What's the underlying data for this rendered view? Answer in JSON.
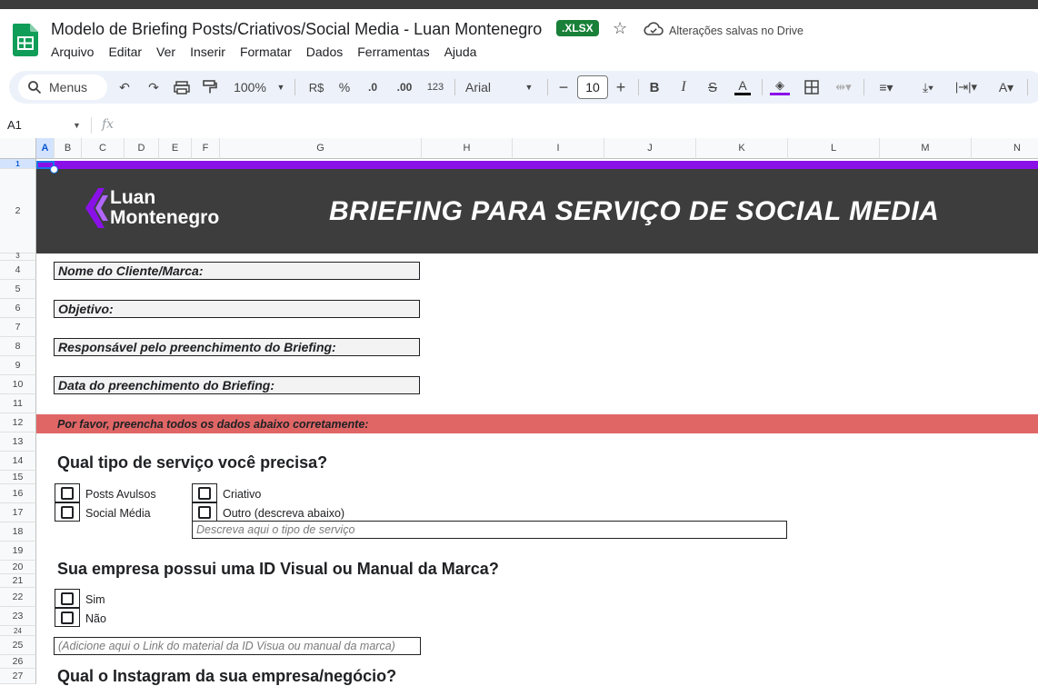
{
  "window": {
    "doc_title": "Modelo de Briefing Posts/Criativos/Social Media - Luan Montenegro",
    "badge": ".XLSX",
    "save_status": "Alterações salvas no Drive"
  },
  "menu": [
    "Arquivo",
    "Editar",
    "Ver",
    "Inserir",
    "Formatar",
    "Dados",
    "Ferramentas",
    "Ajuda"
  ],
  "toolbar": {
    "search_label": "Menus",
    "zoom": "100%",
    "currency": "R$",
    "percent": "%",
    "dec_decrease": ".0",
    "dec_increase": ".00",
    "number_format": "123",
    "font": "Arial",
    "font_size": "10"
  },
  "formula_bar": {
    "cell_ref": "A1",
    "fx": "fx"
  },
  "columns": [
    "A",
    "B",
    "C",
    "D",
    "E",
    "F",
    "G",
    "H",
    "I",
    "J",
    "K",
    "L",
    "M",
    "N"
  ],
  "rows": [
    "1",
    "2",
    "3",
    "4",
    "5",
    "6",
    "7",
    "8",
    "9",
    "10",
    "11",
    "12",
    "13",
    "14",
    "15",
    "16",
    "17",
    "18",
    "19",
    "20",
    "21",
    "22",
    "23",
    "24",
    "25",
    "26",
    "27"
  ],
  "sheet": {
    "brand_line1": "Luan",
    "brand_line2": "Montenegro",
    "banner_title": "BRIEFING PARA SERVIÇO DE SOCIAL MEDIA",
    "fields": [
      "Nome do Cliente/Marca:",
      "Objetivo:",
      "Responsável pelo preenchimento do Briefing:",
      "Data do preenchimento do Briefing:"
    ],
    "notice": "Por favor, preencha todos os dados abaixo corretamente:",
    "q1": {
      "title": "Qual tipo de serviço você precisa?",
      "options": [
        "Posts Avulsos",
        "Social Média",
        "Criativo",
        "Outro (descreva abaixo)"
      ],
      "description_placeholder": "Descreva aqui o tipo de serviço"
    },
    "q2": {
      "title": "Sua empresa possui uma ID Visual ou Manual da Marca?",
      "options": [
        "Sim",
        "Não"
      ],
      "link_placeholder": "(Adicione aqui o Link do material da ID Visua ou manual da marca)"
    },
    "q3": {
      "title": "Qual o Instagram da sua empresa/negócio?"
    }
  },
  "colors": {
    "purple": "#8a10e8",
    "banner": "#3d3d3d",
    "notice": "#e06666",
    "sheets_green": "#188038"
  }
}
